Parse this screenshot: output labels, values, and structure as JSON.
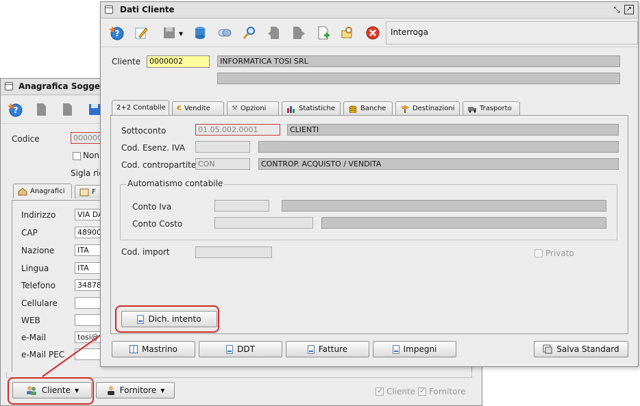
{
  "back_window": {
    "title": "Anagrafica Soggetti",
    "codice_label": "Codice",
    "codice_value": "000000",
    "non_label": "Non",
    "sigla_label": "Sigla ric",
    "tabs": [
      "Anagrafici",
      "F"
    ],
    "fields": [
      {
        "label": "Indirizzo",
        "value": "VIA DA"
      },
      {
        "label": "CAP",
        "value": "48900"
      },
      {
        "label": "Nazione",
        "value": "ITA"
      },
      {
        "label": "Lingua",
        "value": "ITA"
      },
      {
        "label": "Telefono",
        "value": "34878"
      },
      {
        "label": "Cellulare",
        "value": ""
      },
      {
        "label": "WEB",
        "value": ""
      },
      {
        "label": "e-Mail",
        "value": "tosi@"
      },
      {
        "label": "e-Mail PEC",
        "value": ""
      }
    ],
    "cliente_button": "Cliente",
    "fornitore_button": "Fornitore",
    "chk_cliente": "Cliente",
    "chk_fornitore": "Fornitore"
  },
  "front_window": {
    "title": "Dati Cliente",
    "mode_text": "Interroga",
    "cliente_label": "Cliente",
    "cliente_code": "0000002",
    "cliente_name": "INFORMATICA TOSI SRL",
    "cliente_name2": "",
    "tabs": [
      "2+2 Contabile",
      "Vendite",
      "Opzioni",
      "Statistiche",
      "Banche",
      "Destinazioni",
      "Trasporto"
    ],
    "sottoconto_label": "Sottoconto",
    "sottoconto_code": "01.05.002.0001",
    "sottoconto_desc": "CLIENTI",
    "esenz_label": "Cod. Esenz. IVA",
    "esenz_code": "",
    "esenz_desc": "",
    "contro_label": "Cod. contropartite",
    "contro_code": "CON",
    "contro_desc": "CONTROP. ACQUISTO / VENDITA",
    "auto_group": "Automatismo contabile",
    "conto_iva_label": "Conto Iva",
    "conto_costo_label": "Conto Costo",
    "import_label": "Cod. import",
    "privato_label": "Privato",
    "dich_button": "Dich. intento",
    "bottom_buttons": [
      "Mastrino",
      "DDT",
      "Fatture",
      "Impegni"
    ],
    "salva_button": "Salva Standard"
  },
  "colors": {
    "highlight": "#d02828",
    "yellow_field": "#ffff9e"
  }
}
